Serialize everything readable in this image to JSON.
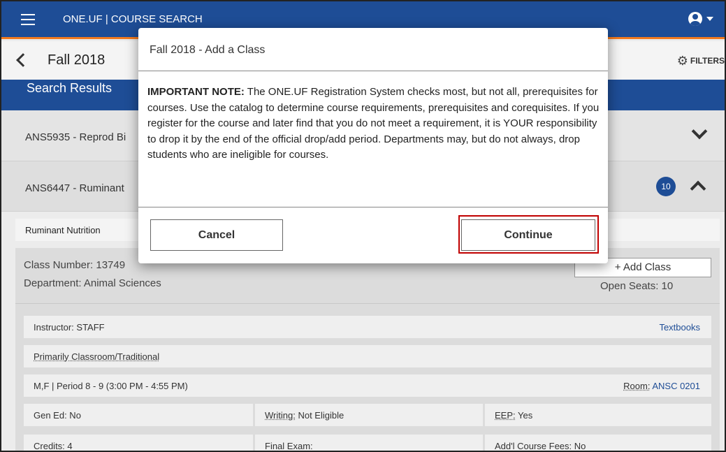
{
  "header": {
    "app_title": "ONE.UF  |  COURSE SEARCH",
    "menu_icon": "hamburger-icon",
    "account_icon": "account-circle-icon"
  },
  "subheader": {
    "term": "Fall 2018",
    "filters_label": "FILTERS"
  },
  "results_title": "Search Results",
  "courses": [
    {
      "code": "ANS5935 - Reprod Bi"
    },
    {
      "code": "ANS6447 - Ruminant",
      "badge": "10"
    }
  ],
  "section": {
    "name": "Ruminant Nutrition",
    "class_number": "Class Number: 13749",
    "department": "Department: Animal Sciences",
    "add_class": "+ Add Class",
    "open_seats": "Open Seats: 10",
    "instructor": "Instructor: STAFF",
    "textbooks": "Textbooks",
    "delivery": "Primarily Classroom/Traditional",
    "schedule": "M,F | Period 8 - 9 (3:00 PM - 4:55 PM)",
    "room_label": "Room:",
    "room_value": "ANSC 0201",
    "gen_ed": "Gen Ed: No",
    "writing_label": "Writing:",
    "writing_value": "Not Eligible",
    "eep_label": "EEP:",
    "eep_value": "Yes",
    "credits": "Credits: 4",
    "final_exam": "Final Exam:",
    "course_fees": "Add'l Course Fees: No"
  },
  "modal": {
    "title": "Fall 2018 - Add a Class",
    "note_label": "IMPORTANT NOTE:",
    "note_text": "The ONE.UF Registration System checks most, but not all, prerequisites for courses. Use the catalog to determine course requirements, prerequisites and corequisites. If you register for the course and later find that you do not meet a requirement, it is YOUR responsibility to drop it by the end of the official drop/add period. Departments may, but do not always, drop students who are ineligible for courses.",
    "cancel_label": "Cancel",
    "continue_label": "Continue"
  },
  "colors": {
    "brand_blue": "#1e4d96",
    "accent_orange": "#f27a1e",
    "highlight_red": "#c00000"
  }
}
